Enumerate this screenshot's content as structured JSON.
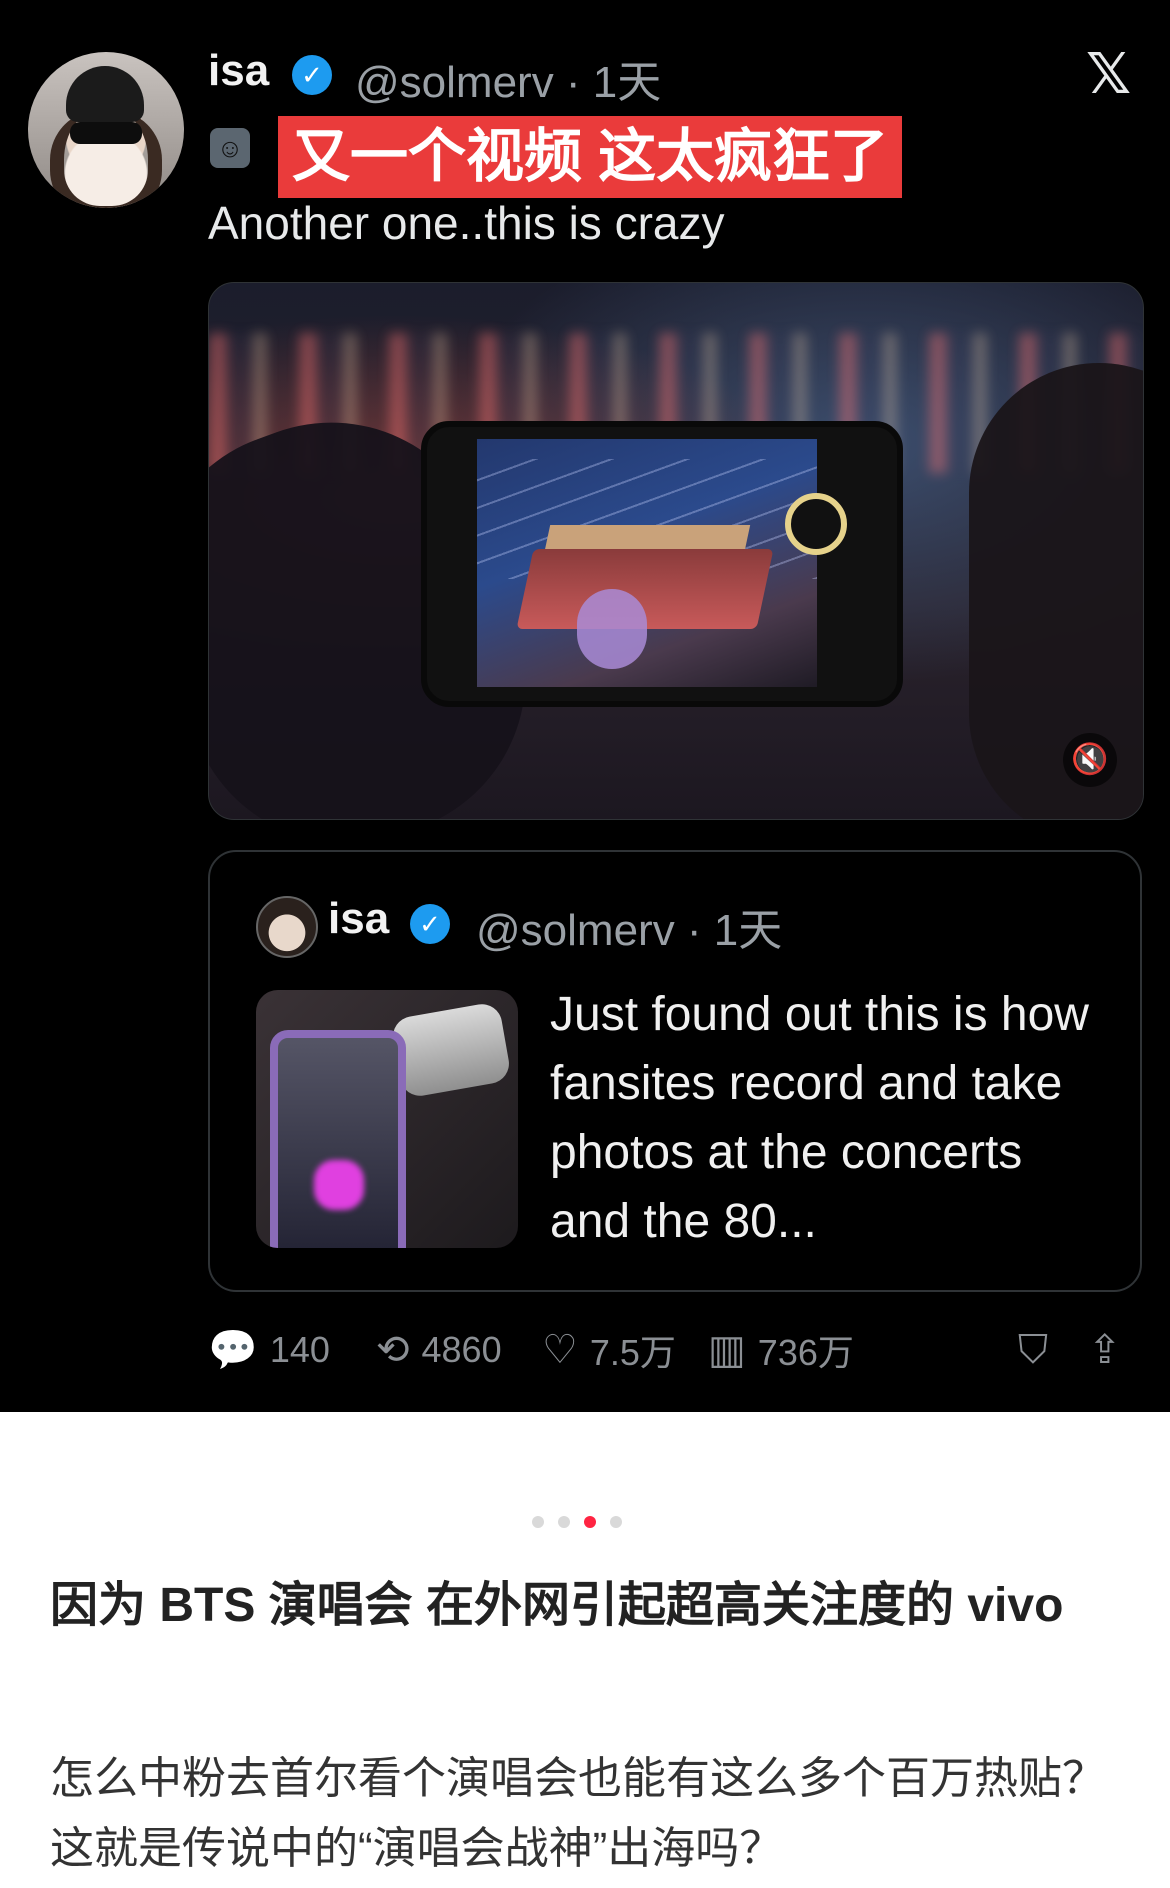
{
  "tweet": {
    "name": "isa",
    "handle_time": "@solmerv · 1天",
    "translation_banner": "又一个视频 这太疯狂了",
    "text": "Another one..this is crazy",
    "x_logo": "𝕏"
  },
  "quoted_tweet": {
    "name": "isa",
    "handle_time": "@solmerv · 1天",
    "text": "Just found out this is how fansites record and take photos at the concerts and the 80..."
  },
  "actions": {
    "replies": "140",
    "retweets": "4860",
    "likes": "7.5万",
    "views": "736万"
  },
  "carousel": {
    "total": 4,
    "active_index": 2
  },
  "post": {
    "title": "因为 BTS 演唱会 在外网引起超高关注度的 vivo",
    "body": "怎么中粉去首尔看个演唱会也能有这么多个百万热贴？这就是传说中的“演唱会战神”出海吗？"
  },
  "icons": {
    "verified": "verified-badge-icon",
    "translate": "translate-mask-icon",
    "mute": "speaker-muted-icon",
    "reply": "reply-icon",
    "retweet": "retweet-icon",
    "like": "heart-icon",
    "views": "views-bar-icon",
    "bookmark": "bookmark-icon",
    "share": "share-icon"
  },
  "colors": {
    "tweet_bg": "#000000",
    "verified": "#1d9bf0",
    "banner": "#ea3b3b",
    "carousel_active": "#ff2442"
  }
}
